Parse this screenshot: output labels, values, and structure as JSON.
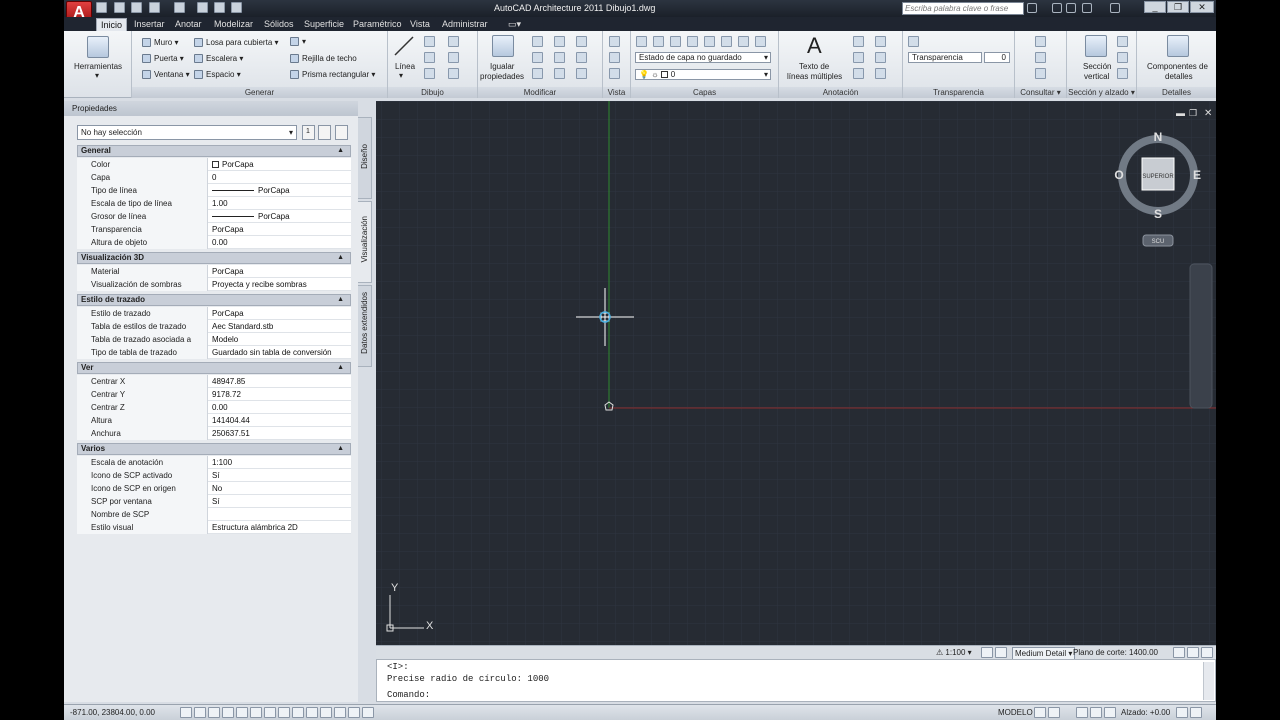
{
  "app": {
    "title": "AutoCAD Architecture 2011    Dibujo1.dwg",
    "search_placeholder": "Escriba palabra clave o frase",
    "logo": "A"
  },
  "tabs": [
    "Inicio",
    "Insertar",
    "Anotar",
    "Modelizar",
    "Sólidos",
    "Superficie",
    "Paramétrico",
    "Vista",
    "Administrar"
  ],
  "ribbon": {
    "herramientas": "Herramientas",
    "generar": {
      "title": "Generar",
      "muro": "Muro",
      "puerta": "Puerta",
      "ventana": "Ventana",
      "losa": "Losa para cubierta",
      "escalera": "Escalera",
      "espacio": "Espacio",
      "rejilla": "Rejilla de techo",
      "prisma": "Prisma rectangular"
    },
    "dibujo": {
      "title": "Dibujo",
      "linea": "Línea"
    },
    "modificar": {
      "title": "Modificar",
      "igualar1": "Igualar",
      "igualar2": "propiedades"
    },
    "vista": {
      "title": "Vista"
    },
    "capas": {
      "title": "Capas",
      "estado": "Estado de capa no guardado",
      "capa": "0"
    },
    "anotacion": {
      "title": "Anotación",
      "texto1": "Texto de",
      "texto2": "líneas múltiples"
    },
    "transparencia": {
      "title": "Transparencia",
      "label": "Transparencia",
      "value": "0"
    },
    "consultar": {
      "title": "Consultar"
    },
    "seccion": {
      "title": "Sección y alzado",
      "s1": "Sección",
      "s2": "vertical"
    },
    "detalles": {
      "title": "Detalles",
      "d1": "Componentes de",
      "d2": "detalles"
    }
  },
  "properties": {
    "title": "Propiedades",
    "selection": "No hay selección",
    "side_tabs": [
      "Diseño",
      "Visualización",
      "Datos extendidos"
    ],
    "sections": [
      {
        "name": "General",
        "rows": [
          [
            "Color",
            "PorCapa"
          ],
          [
            "Capa",
            "0"
          ],
          [
            "Tipo de línea",
            "PorCapa"
          ],
          [
            "Escala de tipo de línea",
            "1.00"
          ],
          [
            "Grosor de línea",
            "PorCapa"
          ],
          [
            "Transparencia",
            "PorCapa"
          ],
          [
            "Altura de objeto",
            "0.00"
          ]
        ]
      },
      {
        "name": "Visualización 3D",
        "rows": [
          [
            "Material",
            "PorCapa"
          ],
          [
            "Visualización de sombras",
            "Proyecta y recibe sombras"
          ]
        ]
      },
      {
        "name": "Estilo de trazado",
        "rows": [
          [
            "Estilo de trazado",
            "PorCapa"
          ],
          [
            "Tabla de estilos de trazado",
            "Aec Standard.stb"
          ],
          [
            "Tabla de trazado asociada a",
            "Modelo"
          ],
          [
            "Tipo de tabla de trazado",
            "Guardado sin tabla de conversión"
          ]
        ]
      },
      {
        "name": "Ver",
        "rows": [
          [
            "Centrar X",
            "48947.85"
          ],
          [
            "Centrar Y",
            "9178.72"
          ],
          [
            "Centrar Z",
            "0.00"
          ],
          [
            "Altura",
            "141404.44"
          ],
          [
            "Anchura",
            "250637.51"
          ]
        ]
      },
      {
        "name": "Varios",
        "rows": [
          [
            "Escala de anotación",
            "1:100"
          ],
          [
            "Icono de SCP activado",
            "Sí"
          ],
          [
            "Icono de SCP en origen",
            "No"
          ],
          [
            "SCP por ventana",
            "Sí"
          ],
          [
            "Nombre de SCP",
            ""
          ],
          [
            "Estilo visual",
            "Estructura alámbrica 2D"
          ]
        ]
      }
    ]
  },
  "viewcube": {
    "n": "N",
    "s": "S",
    "e": "E",
    "w": "O",
    "face": "SUPERIOR",
    "scu": "SCU"
  },
  "ucs": {
    "x": "X",
    "y": "Y"
  },
  "viewport_bar": {
    "scale": "1:100",
    "detail": "Medium Detail",
    "cut_label": "Plano de corte:",
    "cut_value": "1400.00"
  },
  "command": {
    "lines": [
      "<I>:",
      "Precise radio de círculo: 1000",
      "Comando:"
    ]
  },
  "status": {
    "coords": "-871.00,  23804.00, 0.00",
    "modelo": "MODELO",
    "alzado_label": "Alzado:",
    "alzado_value": "+0.00"
  }
}
